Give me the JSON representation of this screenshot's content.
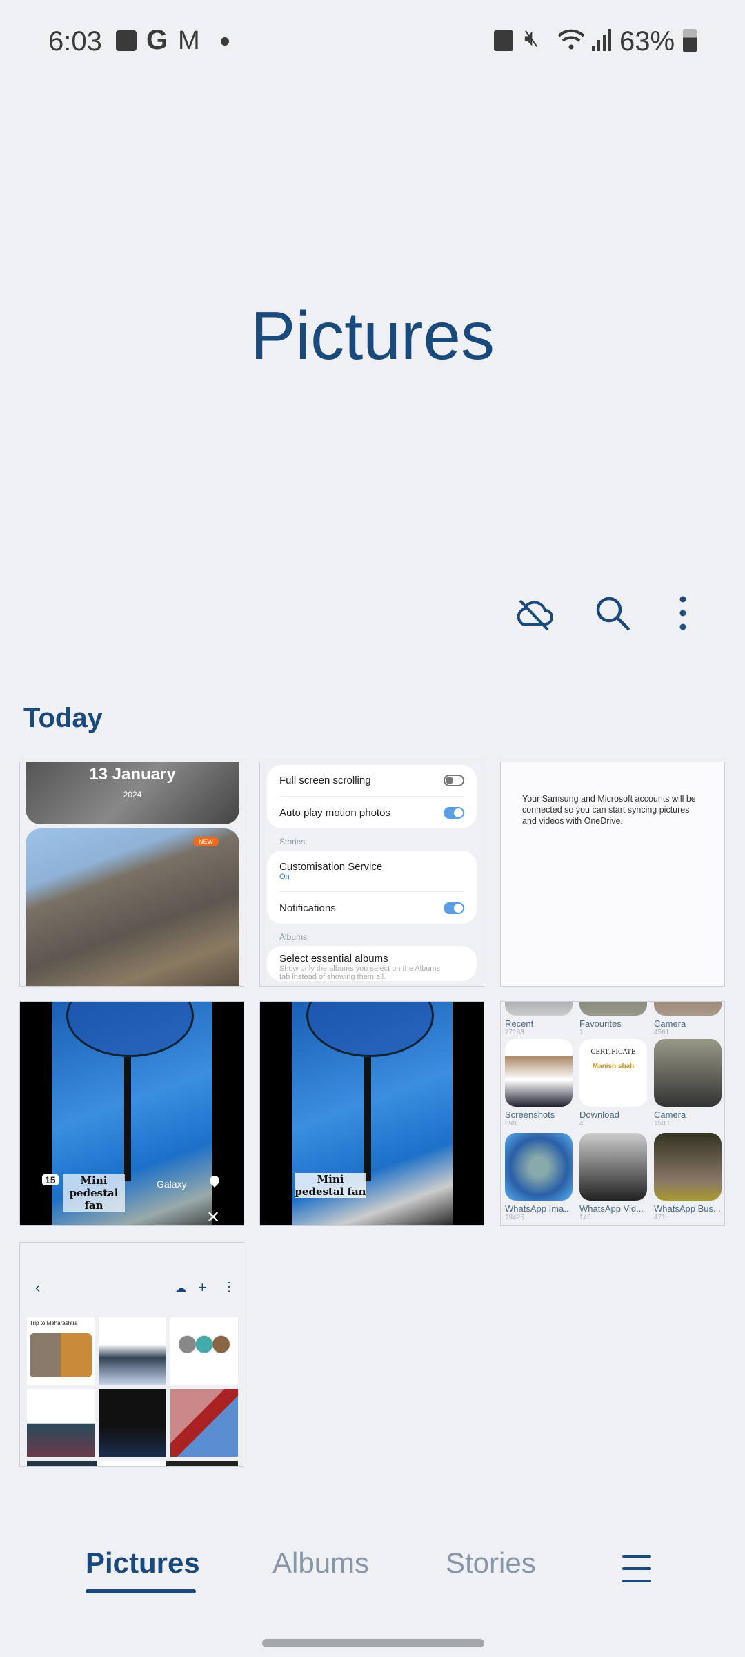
{
  "status_bar": {
    "time": "6:03",
    "battery": "63%",
    "battery_level": 0.63,
    "left_icons": [
      "gallery-icon",
      "google-icon",
      "gmail-icon",
      "dot-icon"
    ],
    "right_icons": [
      "work-profile-icon",
      "mute-icon",
      "wifi-icon",
      "signal-icon",
      "battery-icon"
    ]
  },
  "header": {
    "title": "Pictures",
    "actions": [
      "cloud-off-icon",
      "search-icon",
      "more-vert-icon"
    ]
  },
  "section": {
    "label": "Today"
  },
  "tiles": {
    "t1": {
      "date": "13 January",
      "year": "2024",
      "badge": "NEW"
    },
    "t2": {
      "full_screen": "Full screen scrolling",
      "full_screen_on": false,
      "auto_play": "Auto play motion photos",
      "auto_play_on": true,
      "stories": "Stories",
      "custom": "Customisation Service",
      "custom_value": "On",
      "notifications": "Notifications",
      "notifications_on": true,
      "albums": "Albums",
      "essential": "Select essential albums",
      "essential_desc": "Show only the albums you select on the Albums tab instead of showing them all.",
      "essential_on": true
    },
    "t3": {
      "text": "Your Samsung and Microsoft accounts will be connected so you can start syncing pictures and videos with OneDrive."
    },
    "t4": {
      "caption": "Mini pedestal fan",
      "day": "15",
      "brand": "Galaxy"
    },
    "t5": {
      "caption": "Mini pedestal fan"
    },
    "t6": {
      "albums": [
        {
          "name": "Recent",
          "count": "27163"
        },
        {
          "name": "Favourites",
          "count": "1"
        },
        {
          "name": "Camera",
          "count": "4561"
        },
        {
          "name": "Screenshots",
          "count": "698"
        },
        {
          "name": "Download",
          "count": "4"
        },
        {
          "name": "Camera",
          "count": "1503"
        },
        {
          "name": "WhatsApp Ima...",
          "count": "19425"
        },
        {
          "name": "WhatsApp Vid...",
          "count": "146"
        },
        {
          "name": "WhatsApp Bus...",
          "count": "471"
        }
      ],
      "certificate": "CERTIFICATE",
      "cert_name": "Manish shah"
    },
    "t7": {
      "album_title": "Trip to Maharashtra"
    }
  },
  "bottom_nav": {
    "items": [
      {
        "label": "Pictures",
        "active": true
      },
      {
        "label": "Albums"
      },
      {
        "label": "Stories"
      }
    ],
    "menu_icon": "hamburger-icon"
  },
  "colors": {
    "accent": "#1a4a7c",
    "background": "#eef0f4",
    "inactive": "#8896aa"
  }
}
